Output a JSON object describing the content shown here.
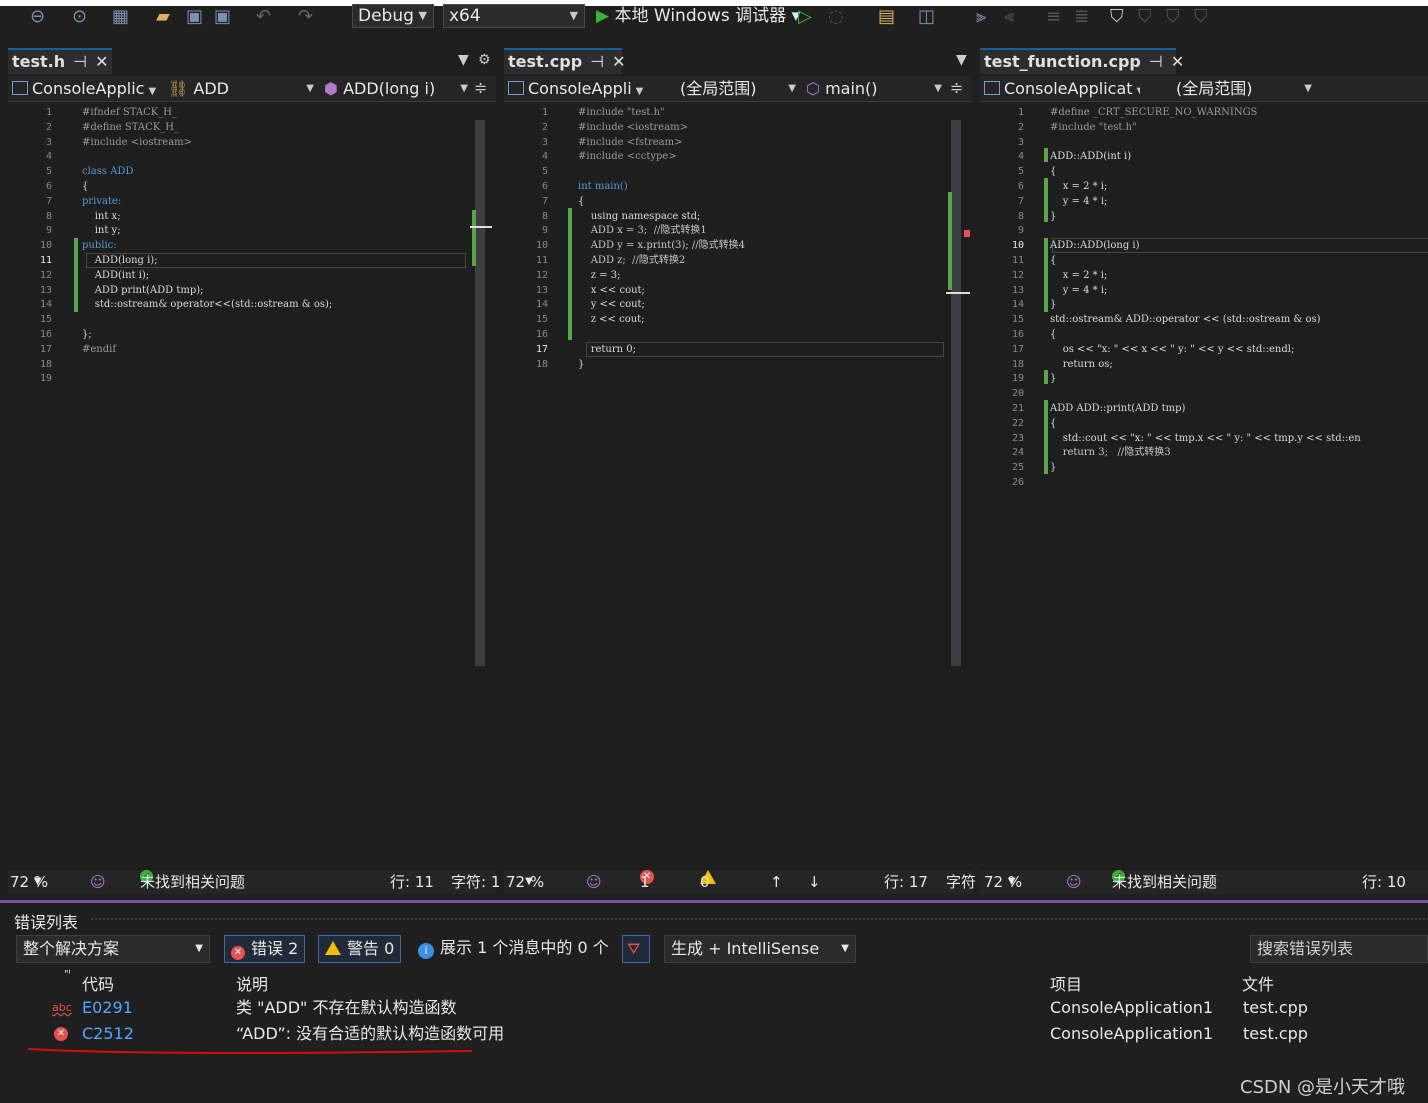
{
  "toolbar": {
    "config": "Debug",
    "platform": "x64",
    "debugger": "本地 Windows 调试器"
  },
  "panes": [
    {
      "tab": "test.h",
      "nav_project": "ConsoleApplic",
      "nav_scope": "ADD",
      "nav_member": "ADD(long i)",
      "zoom": "72 %",
      "status_msg": "未找到相关问题",
      "line": "行: 11",
      "char": "字符: 1",
      "line_numbers": [
        "1",
        "2",
        "3",
        "4",
        "5",
        "6",
        "7",
        "8",
        "9",
        "10",
        "11",
        "12",
        "13",
        "14",
        "15",
        "16",
        "17",
        "18",
        "19"
      ],
      "code": [
        "#ifndef STACK_H_",
        "#define STACK_H_",
        "#include <iostream>",
        "",
        "class ADD",
        "{",
        "private:",
        "    int x;",
        "    int y;",
        "public:",
        "    ADD(long i);",
        "    ADD(int i);",
        "    ADD print(ADD tmp);",
        "    std::ostream& operator<<(std::ostream & os);",
        "",
        "};",
        "#endif",
        "",
        ""
      ]
    },
    {
      "tab": "test.cpp",
      "nav_project": "ConsoleAppli",
      "nav_scope": "(全局范围)",
      "nav_member": "main()",
      "zoom": "72 %",
      "errors": "1",
      "warnings": "0",
      "line": "行: 17",
      "char": "字符",
      "line_numbers": [
        "1",
        "2",
        "3",
        "4",
        "5",
        "6",
        "7",
        "8",
        "9",
        "10",
        "11",
        "12",
        "13",
        "14",
        "15",
        "16",
        "17",
        "18"
      ],
      "code": [
        "#include \"test.h\"",
        "#include <iostream>",
        "#include <fstream>",
        "#include <cctype>",
        "",
        "int main()",
        "{",
        "    using namespace std;",
        "    ADD x = 3;  //隐式转换1",
        "    ADD y = x.print(3); //隐式转换4",
        "    ADD z;  //隐式转换2",
        "    z = 3;",
        "    x << cout;",
        "    y << cout;",
        "    z << cout;",
        "",
        "    return 0;",
        "}"
      ]
    },
    {
      "tab": "test_function.cpp",
      "nav_project": "ConsoleApplicat",
      "nav_scope": "(全局范围)",
      "zoom": "72 %",
      "status_msg": "未找到相关问题",
      "line": "行: 10",
      "line_numbers": [
        "1",
        "2",
        "3",
        "4",
        "5",
        "6",
        "7",
        "8",
        "9",
        "10",
        "11",
        "12",
        "13",
        "14",
        "15",
        "16",
        "17",
        "18",
        "19",
        "20",
        "21",
        "22",
        "23",
        "24",
        "25",
        "26"
      ],
      "code": [
        "#define _CRT_SECURE_NO_WARNINGS",
        "#include \"test.h\"",
        "",
        "ADD::ADD(int i)",
        "{",
        "    x = 2 * i;",
        "    y = 4 * i;",
        "}",
        "",
        "ADD::ADD(long i)",
        "{",
        "    x = 2 * i;",
        "    y = 4 * i;",
        "}",
        "std::ostream& ADD::operator << (std::ostream & os)",
        "{",
        "    os << \"x: \" << x << \" y: \" << y << std::endl;",
        "    return os;",
        "}",
        "",
        "ADD ADD::print(ADD tmp)",
        "{",
        "    std::cout << \"x: \" << tmp.x << \" y: \" << tmp.y << std::en",
        "    return 3;   //隐式转换3",
        "}",
        ""
      ]
    }
  ],
  "error_list": {
    "title": "错误列表",
    "scope": "整个解决方案",
    "errors_btn": "错误 2",
    "warnings_btn": "警告 0",
    "messages": "展示 1 个消息中的 0 个",
    "build_filter": "生成 + IntelliSense",
    "search_placeholder": "搜索错误列表",
    "columns": {
      "code": "代码",
      "desc": "说明",
      "project": "项目",
      "file": "文件"
    },
    "rows": [
      {
        "code": "E0291",
        "desc": "类 \"ADD\" 不存在默认构造函数",
        "project": "ConsoleApplication1",
        "file": "test.cpp"
      },
      {
        "code": "C2512",
        "desc": "“ADD”: 没有合适的默认构造函数可用",
        "project": "ConsoleApplication1",
        "file": "test.cpp"
      }
    ]
  },
  "watermark": "CSDN @是小天才哦",
  "colors": {
    "accent": "#0e639c",
    "error": "#e55050",
    "ok": "#3bb33b",
    "underline": "#d01010"
  }
}
